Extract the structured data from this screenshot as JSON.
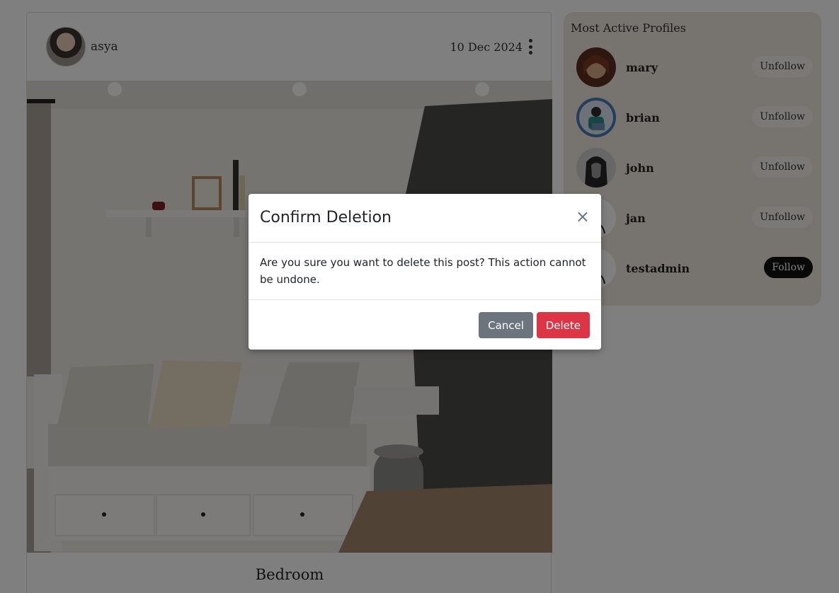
{
  "post": {
    "author": "asya",
    "date": "10 Dec 2024",
    "caption": "Bedroom"
  },
  "sidebar": {
    "title": "Most Active Profiles",
    "profiles": [
      {
        "name": "mary",
        "button": "Unfollow"
      },
      {
        "name": "brian",
        "button": "Unfollow"
      },
      {
        "name": "john",
        "button": "Unfollow"
      },
      {
        "name": "jan",
        "button": "Unfollow"
      },
      {
        "name": "testadmin",
        "button": "Follow"
      }
    ]
  },
  "modal": {
    "title": "Confirm Deletion",
    "close": "×",
    "body": "Are you sure you want to delete this post? This action cannot be undone.",
    "cancel_label": "Cancel",
    "delete_label": "Delete"
  },
  "colors": {
    "sidebar_bg": "#eee7dd",
    "delete": "#dc3545",
    "cancel": "#6c757d",
    "follow": "#111111"
  }
}
